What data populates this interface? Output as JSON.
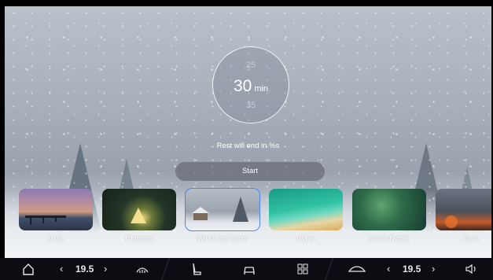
{
  "timer": {
    "prev_value": "25",
    "current_value": "30",
    "unit": "min",
    "next_value": "35"
  },
  "status_text": "Rest will end in %s",
  "start_label": "Start",
  "scenes": [
    {
      "label": "Mute",
      "selected": false
    },
    {
      "label": "Chirping",
      "selected": false
    },
    {
      "label": "Wind and snow",
      "selected": true
    },
    {
      "label": "Wave",
      "selected": false
    },
    {
      "label": "Bird's twitter",
      "selected": false
    },
    {
      "label": "Rain",
      "selected": false
    }
  ],
  "bottom_bar": {
    "left_temp": "19.5",
    "right_temp": "19.5"
  },
  "colors": {
    "selected_outline": "#4a86ff",
    "bar_bg": "#0b0d12"
  }
}
